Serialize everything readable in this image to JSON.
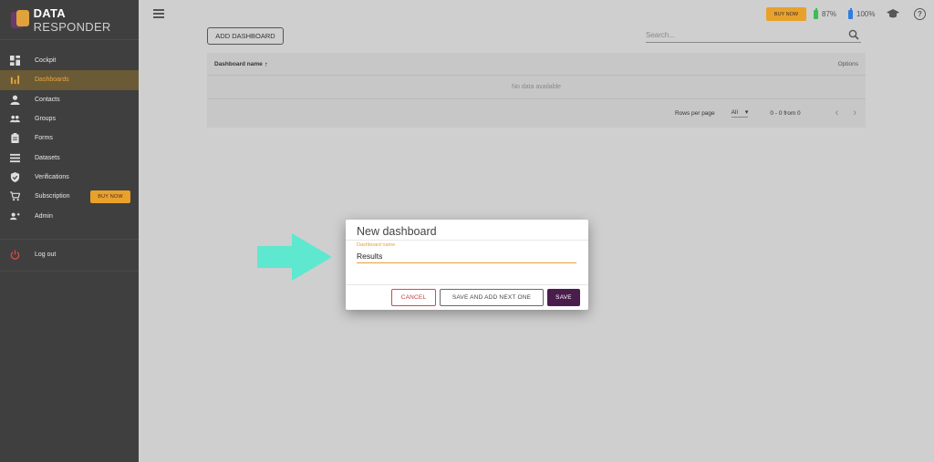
{
  "brand": {
    "bold": "DATA",
    "rest": " RESPONDER"
  },
  "sidebar": {
    "items": [
      {
        "label": "Cockpit"
      },
      {
        "label": "Dashboards"
      },
      {
        "label": "Contacts"
      },
      {
        "label": "Groups"
      },
      {
        "label": "Forms"
      },
      {
        "label": "Datasets"
      },
      {
        "label": "Verifications"
      },
      {
        "label": "Subscription",
        "badge": "BUY NOW"
      },
      {
        "label": "Admin"
      }
    ],
    "logout": "Log out"
  },
  "topbar": {
    "buy_now": "BUY NOW",
    "battery1": "87%",
    "battery2": "100%",
    "battery1_color": "#3dbb55",
    "battery2_color": "#2e7de0"
  },
  "main": {
    "add_button": "ADD DASHBOARD",
    "search_placeholder": "Search...",
    "table": {
      "col_name": "Dashboard name",
      "sort_indicator": "↑",
      "col_options": "Options",
      "empty": "No data available",
      "rows_per_page_label": "Rows per page",
      "rows_per_page_value": "All",
      "range": "0 - 0 from 0"
    }
  },
  "dialog": {
    "title": "New dashboard",
    "field_label": "Dashboard name",
    "field_value": "Results",
    "cancel": "CANCEL",
    "save_next": "SAVE AND ADD NEXT ONE",
    "save": "SAVE"
  },
  "colors": {
    "accent": "#e6a03a",
    "sidebar_bg": "#3f3f3f",
    "save_bg": "#4a1d4d",
    "arrow": "#5ee8cf"
  }
}
